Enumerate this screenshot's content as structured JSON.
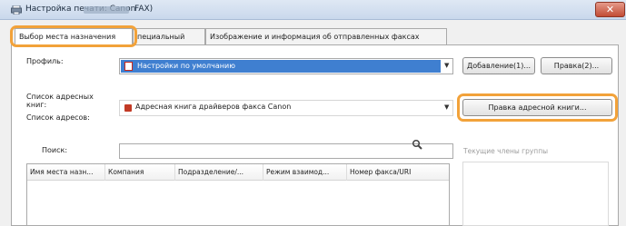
{
  "window": {
    "title_prefix": "Настройка печати: Canon",
    "title_suffix": "FAX)",
    "close_glyph": "✕"
  },
  "tabs": [
    {
      "label": "Выбор места назначения",
      "active": true
    },
    {
      "label": "пециальный",
      "active": false
    },
    {
      "label": "Изображение и информация об отправленных факсах",
      "active": false
    }
  ],
  "profile": {
    "label": "Профиль:",
    "selected": "Настройки по умолчанию",
    "add_button": "Добавление(1)...",
    "edit_button": "Правка(2)..."
  },
  "address_book": {
    "list_label": "Список адресных книг:",
    "selected": "Адресная книга драйверов факса Canon",
    "edit_button": "Правка адресной книги...",
    "addresses_label": "Список адресов:"
  },
  "search": {
    "label": "Поиск:",
    "value": ""
  },
  "address_list": {
    "columns": [
      "Имя места назн...",
      "Компания",
      "Подразделение/...",
      "Режим взаимод...",
      "Номер факса/URI"
    ]
  },
  "group_members": {
    "label": "Текущие члены группы"
  },
  "colors": {
    "highlight": "#f2a23a",
    "selection": "#3f7fd0",
    "close_button": "#c24c35"
  },
  "icons": [
    "printer-fax-icon",
    "profile-icon",
    "address-book-icon",
    "magnifier-icon",
    "dropdown-arrow-icon",
    "close-icon"
  ]
}
